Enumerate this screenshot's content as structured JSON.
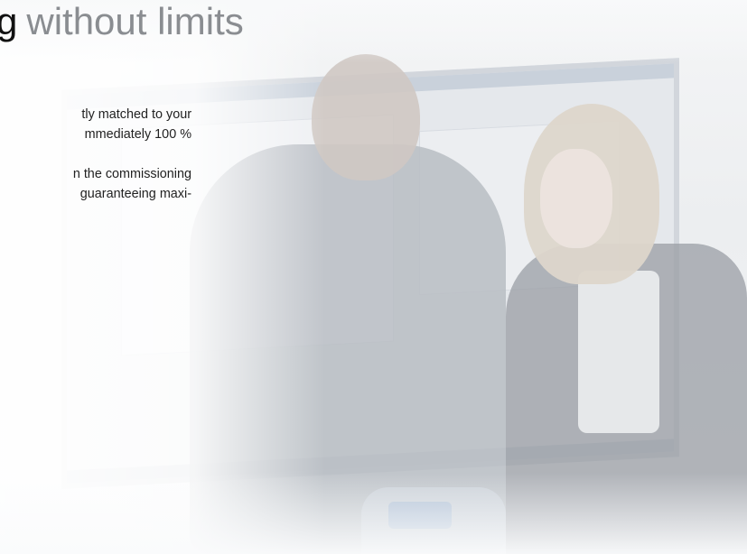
{
  "headline": {
    "lead": "g",
    "accent": "without limits"
  },
  "paragraph_1": {
    "line_1": "tly matched to your",
    "line_2": "mmediately  100  %"
  },
  "paragraph_2": {
    "line_1": "n the commissioning",
    "line_2": "guaranteeing maxi-"
  },
  "colors": {
    "headline_text": "#111111",
    "headline_accent": "#8a8d91",
    "body_text": "#222222"
  }
}
